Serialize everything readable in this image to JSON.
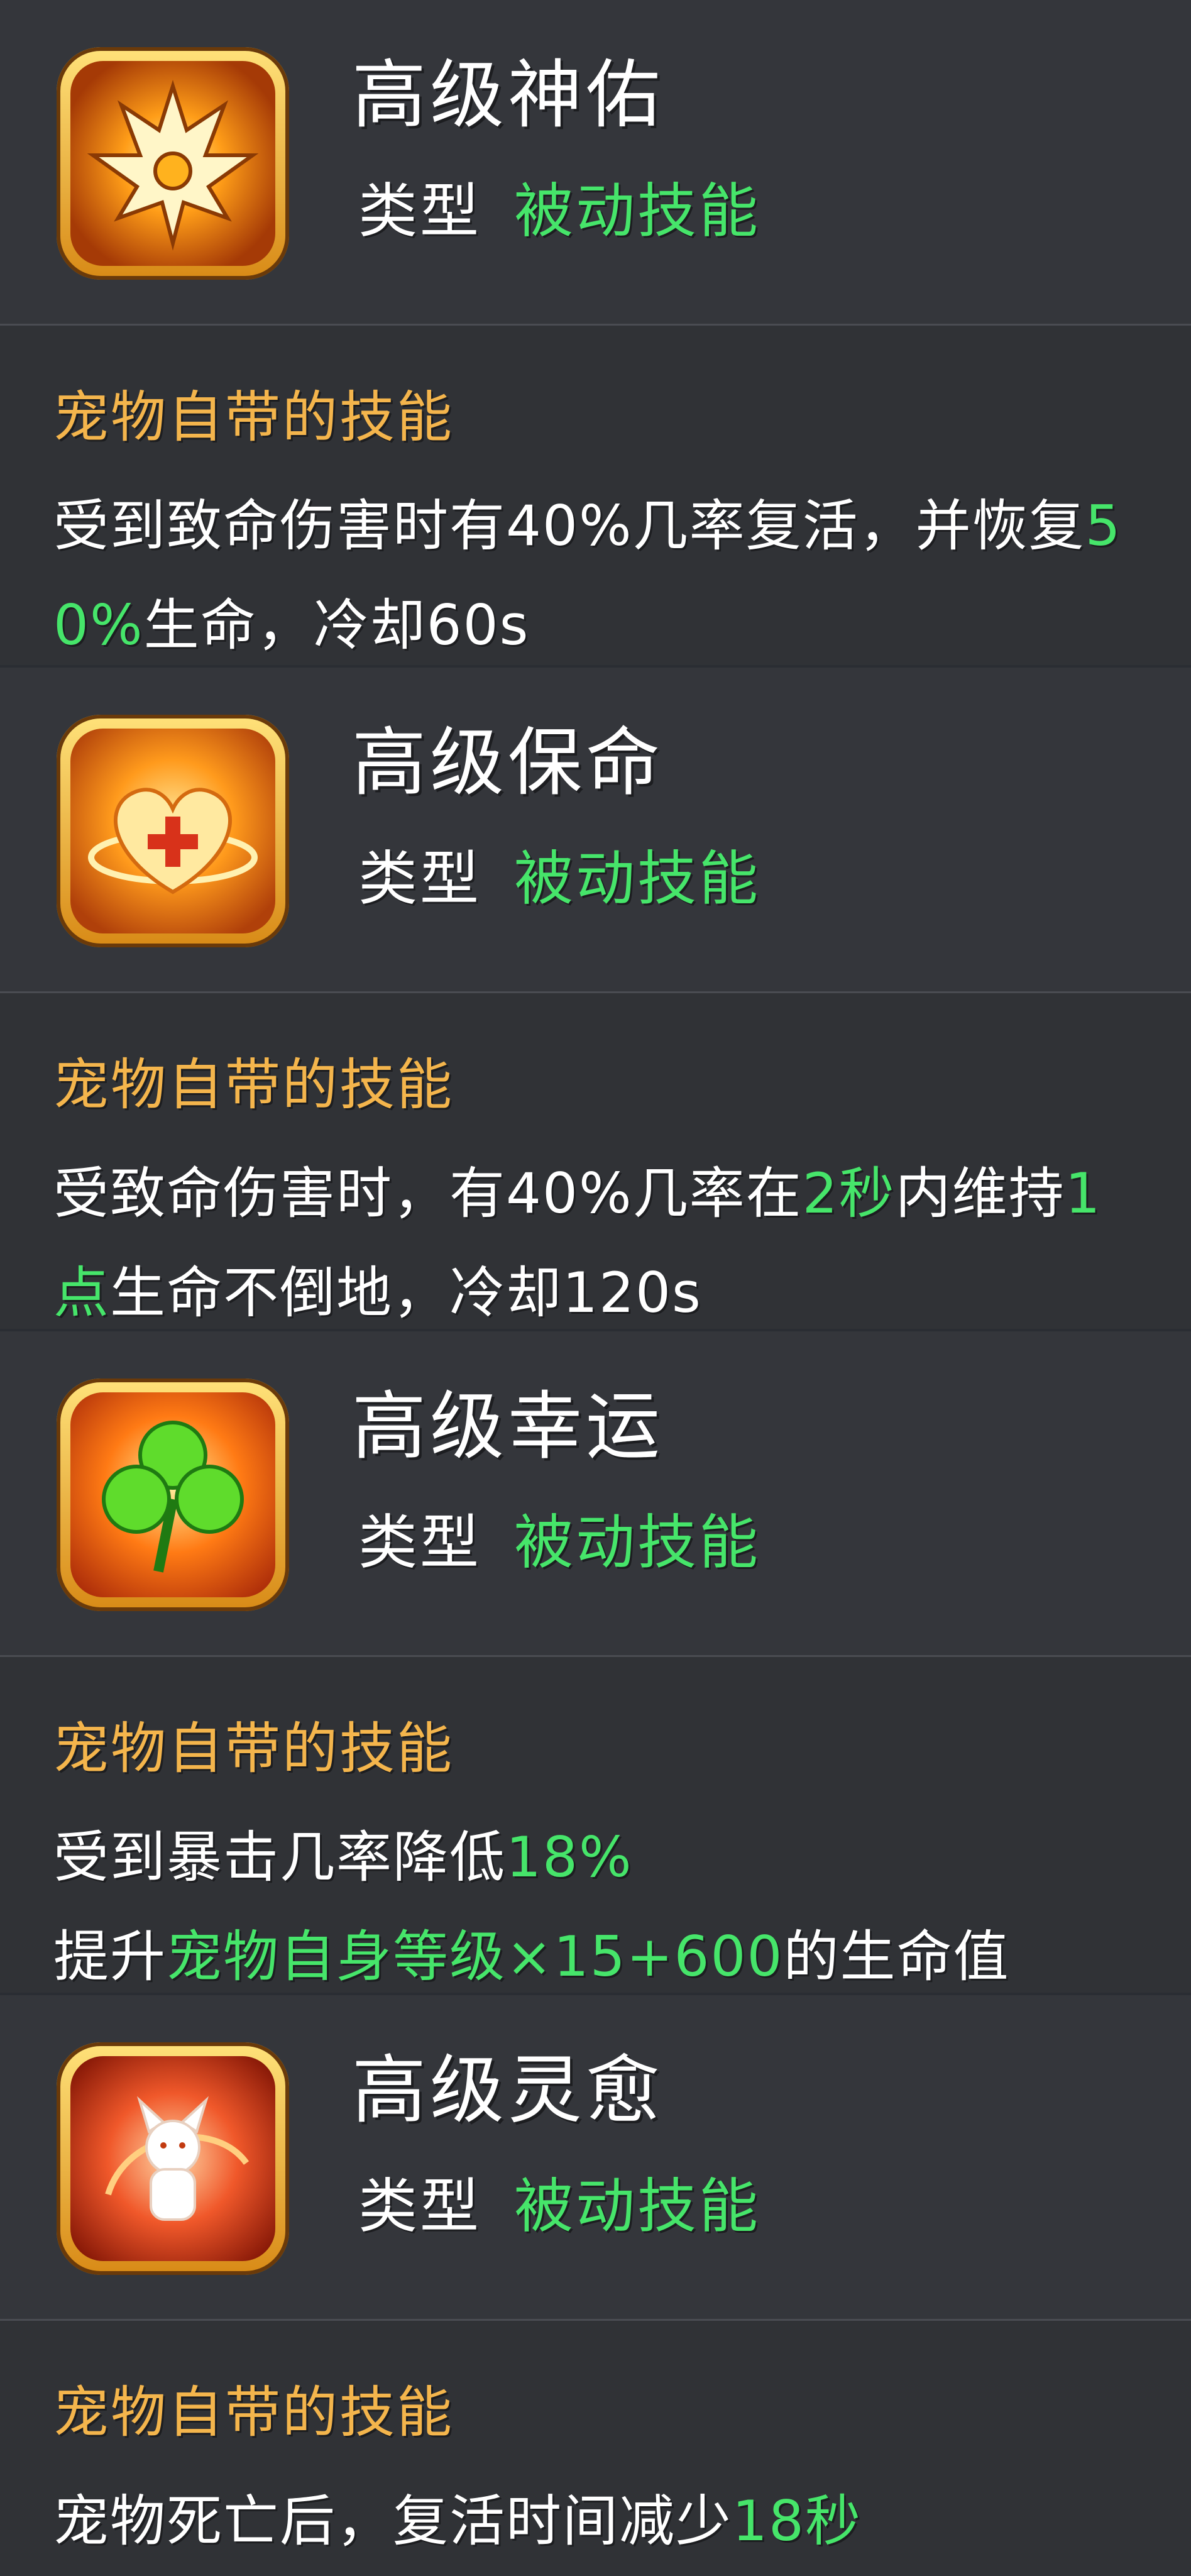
{
  "skills": [
    {
      "icon": "winged-crown-icon",
      "title": "高级神佑",
      "type_label": "类型",
      "type_value": "被动技能",
      "subhead": "宠物自带的技能",
      "desc": [
        {
          "t": "受到致命伤害时有40%几率复活，并恢复",
          "g": false
        },
        {
          "t": "5",
          "g": true
        },
        {
          "t": "0%",
          "g": true
        },
        {
          "t": "生命，冷却60s",
          "g": false
        }
      ]
    },
    {
      "icon": "heart-plus-icon",
      "title": "高级保命",
      "type_label": "类型",
      "type_value": "被动技能",
      "subhead": "宠物自带的技能",
      "desc": [
        {
          "t": "受致命伤害时，有40%几率在",
          "g": false
        },
        {
          "t": "2秒",
          "g": true
        },
        {
          "t": "内维持",
          "g": false
        },
        {
          "t": "1",
          "g": true
        },
        {
          "t": "点",
          "g": true
        },
        {
          "t": "生命不倒地，冷却120s",
          "g": false
        }
      ]
    },
    {
      "icon": "clover-icon",
      "title": "高级幸运",
      "type_label": "类型",
      "type_value": "被动技能",
      "subhead": "宠物自带的技能",
      "desc": [
        {
          "t": "受到暴击几率降低",
          "g": false
        },
        {
          "t": "18%",
          "g": true
        },
        {
          "t": "提升",
          "g": false
        },
        {
          "t": "宠物自身等级×15+600",
          "g": true
        },
        {
          "t": "的生命值",
          "g": false
        }
      ]
    },
    {
      "icon": "fox-spirit-icon",
      "title": "高级灵愈",
      "type_label": "类型",
      "type_value": "被动技能",
      "subhead": "宠物自带的技能",
      "desc": [
        {
          "t": "宠物死亡后，复活时间减少",
          "g": false
        },
        {
          "t": "18秒",
          "g": true
        }
      ]
    }
  ],
  "colors": {
    "accent_green": "#46e56a",
    "subhead_orange": "#f4b54c",
    "panel_bg": "#34363b"
  }
}
